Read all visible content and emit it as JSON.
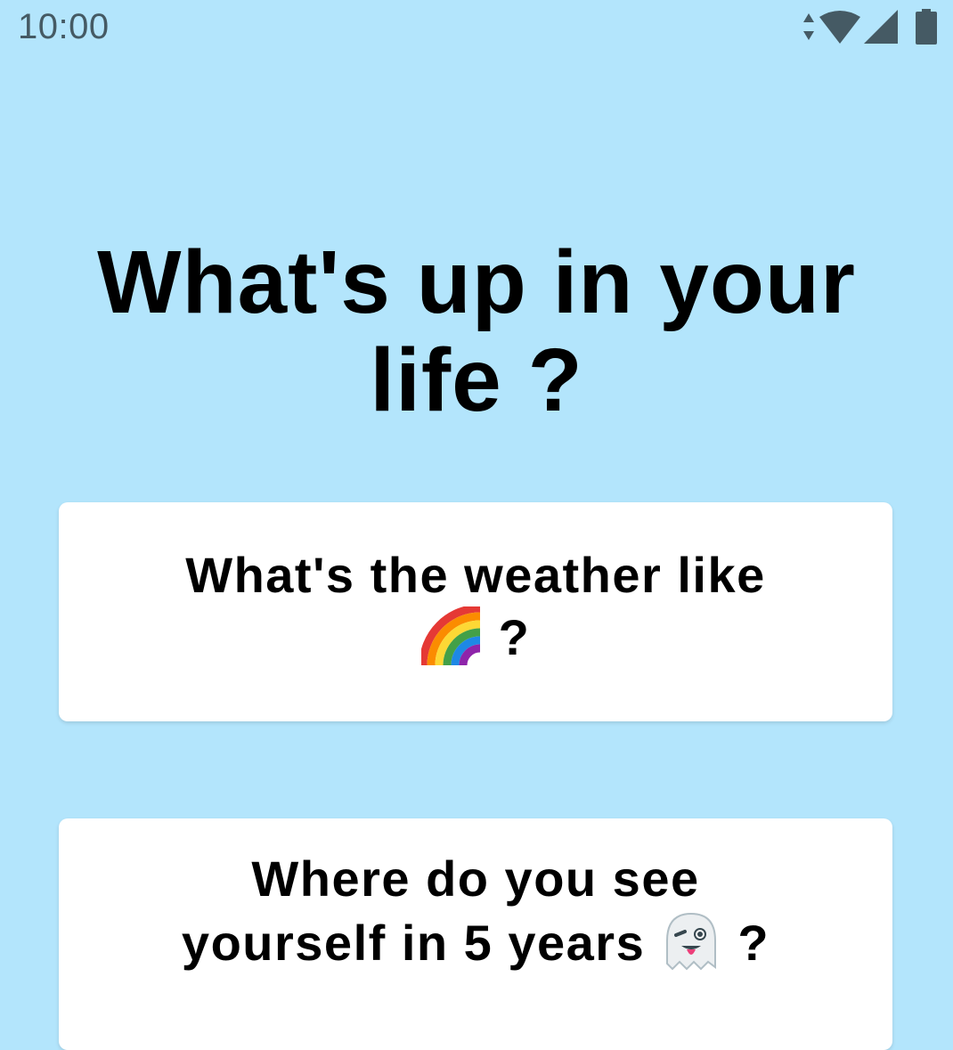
{
  "status_bar": {
    "time": "10:00",
    "icons": [
      "data-arrows-icon",
      "wifi-icon",
      "cell-signal-icon",
      "battery-icon"
    ]
  },
  "title": "What's up in your life ?",
  "cards": [
    {
      "text_before": "What's the weather like",
      "emoji": "rainbow-icon",
      "text_after": "?"
    },
    {
      "text_before": "Where do you see yourself in 5 years",
      "emoji": "ghost-icon",
      "text_after": "?"
    }
  ],
  "colors": {
    "background": "#b3e5fc",
    "card": "#ffffff",
    "status_text": "#455a64"
  }
}
